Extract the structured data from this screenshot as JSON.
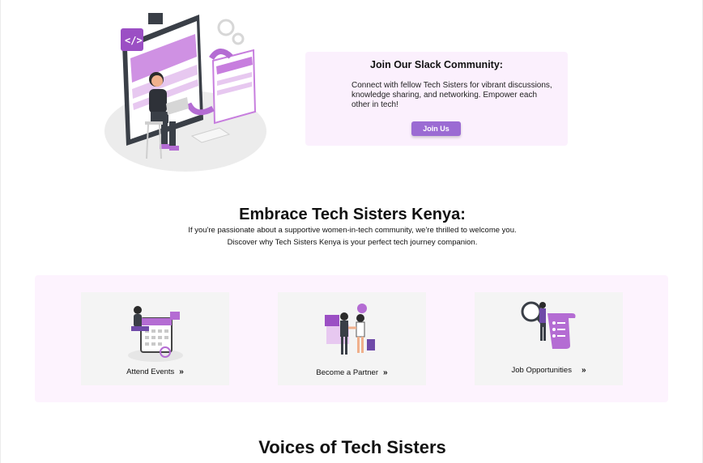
{
  "slack": {
    "title": "Join Our Slack Community:",
    "description": "Connect with fellow Tech Sisters for vibrant discussions, knowledge sharing, and networking. Empower each other in tech!",
    "button_label": "Join Us"
  },
  "embrace": {
    "title": "Embrace Tech Sisters Kenya:",
    "line1": "If you're passionate about a supportive women-in-tech community, we're thrilled to welcome you.",
    "line2": "Discover why Tech Sisters Kenya is your perfect tech journey companion."
  },
  "cards": [
    {
      "label": "Attend Events",
      "icon": "calendar-illustration"
    },
    {
      "label": "Become a Partner",
      "icon": "handshake-illustration"
    },
    {
      "label": "Job Opportunities",
      "icon": "job-search-illustration"
    }
  ],
  "chevron": "»",
  "voices": {
    "title": "Voices of Tech Sisters"
  },
  "colors": {
    "accent": "#9b6bd3",
    "card_bg": "#fbf0fd",
    "band_bg": "#fdf3fe",
    "tile_bg": "#f4f4f4"
  }
}
